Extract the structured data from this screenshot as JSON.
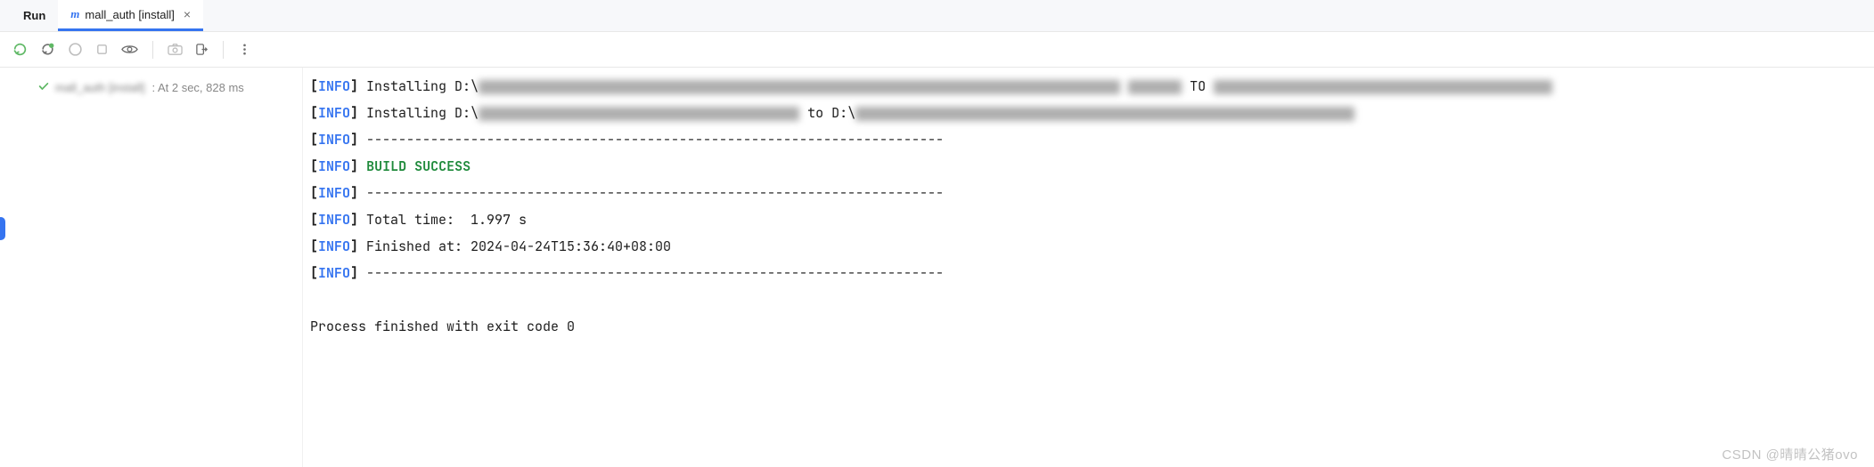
{
  "tabs": {
    "run_label": "Run",
    "active_label": "mall_auth [install]"
  },
  "tree": {
    "item_label": "mall_auth [install]",
    "item_detail": ": At 2 sec, 828 ms"
  },
  "console": {
    "info_token": "INFO",
    "line1_prefix": " Installing D:\\",
    "line2_prefix": " Installing D:\\",
    "line2_mid": " to D:\\",
    "divider": " ------------------------------------------------------------------------",
    "build_success": "BUILD SUCCESS",
    "total_time": " Total time:  1.997 s",
    "finished_at": " Finished at: 2024-04-24T15:36:40+08:00",
    "exit_line": "Process finished with exit code 0"
  },
  "watermark": "CSDN @晴晴公猪ovo"
}
